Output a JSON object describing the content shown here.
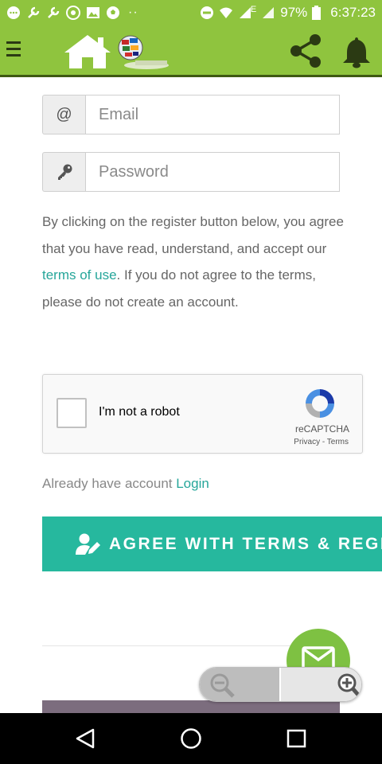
{
  "status_bar": {
    "battery": "97%",
    "time": "6:37:23",
    "network": "E",
    "icons": [
      "chat-icon",
      "wrench-icon",
      "wrench-icon",
      "chrome-icon",
      "image-icon",
      "soccer-icon",
      "more-dots",
      "minus-circle-icon",
      "wifi-icon",
      "signal-icon",
      "battery-icon"
    ]
  },
  "app_bar": {
    "icons": [
      "menu-icon",
      "home-icon",
      "globe-logo",
      "share-icon",
      "bell-icon"
    ]
  },
  "form": {
    "email_addon": "@",
    "email_placeholder": "Email",
    "password_placeholder": "Password",
    "terms_before": "By clicking on the register button below, you agree that you have read, understand, and accept our ",
    "terms_link": "terms of use",
    "terms_after": ". If you do not agree to the terms, please do not create an account.",
    "already_text": "Already have account ",
    "login_link": "Login",
    "agree_button": "AGREE WITH TERMS & REGISTER"
  },
  "recaptcha": {
    "label": "I'm not a robot",
    "brand": "reCAPTCHA",
    "links": "Privacy - Terms"
  },
  "colors": {
    "accent_green": "#8fc43e",
    "teal": "#26b89e",
    "link_teal": "#26a69a",
    "dark_border": "#3f5a12"
  }
}
